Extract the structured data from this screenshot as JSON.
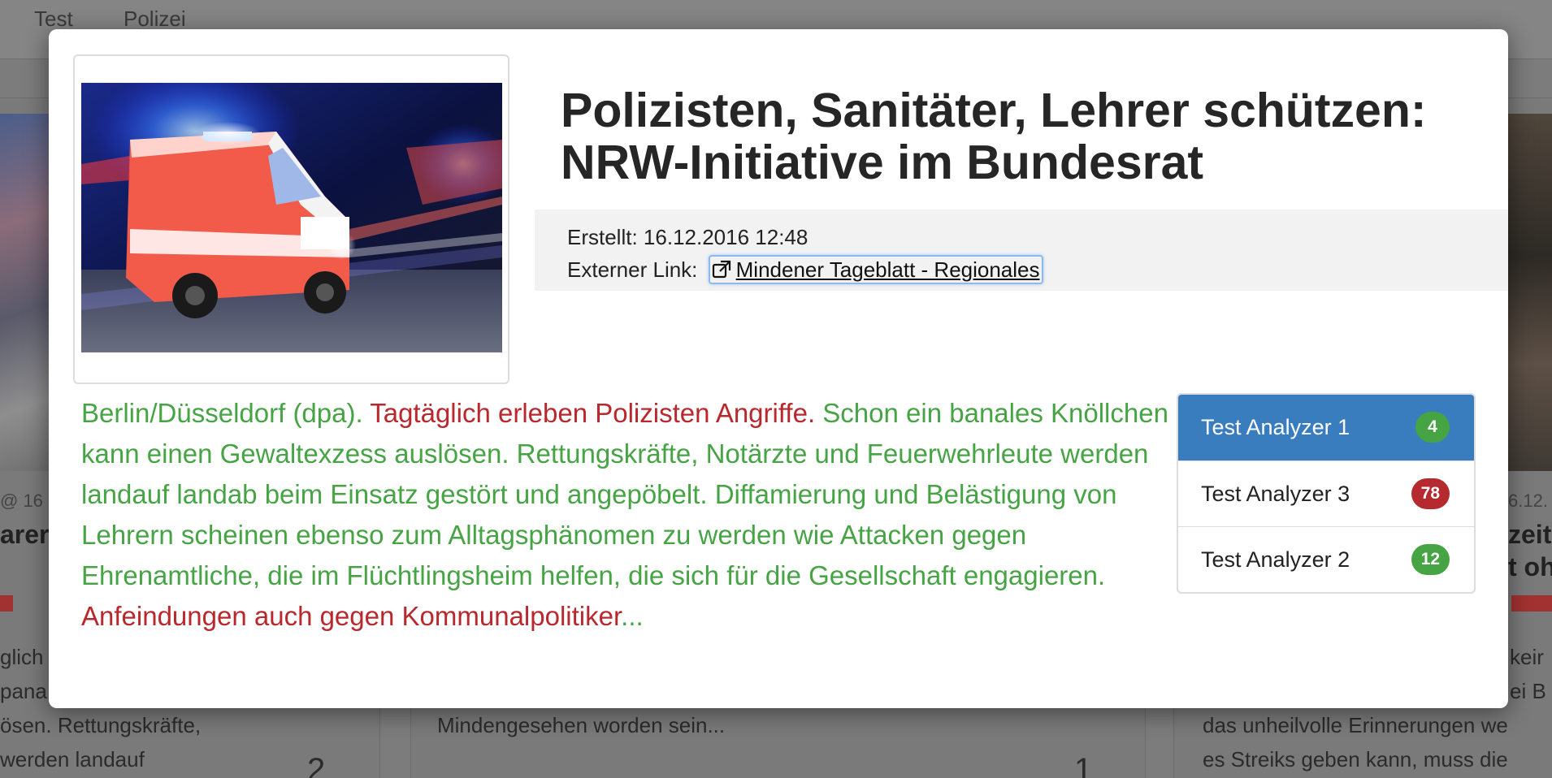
{
  "background": {
    "nav_items": [
      "Test",
      "Polizei"
    ],
    "left_card": {
      "date_fragment": "@ 16",
      "title_fragment": "arer",
      "text_lines": [
        "glich",
        "pana",
        "ösen. Rettungskräfte,",
        "werden landauf"
      ],
      "count": "2"
    },
    "middle_card": {
      "text": "Mindengesehen worden sein...",
      "count": "1"
    },
    "right_card": {
      "date_fragment": "6.12.",
      "title_lines": [
        "zeit",
        "t oh"
      ],
      "text_lines": [
        "keir",
        "ei B",
        "das unheilvolle Erinnerungen we",
        "es Streiks geben kann, muss die"
      ]
    }
  },
  "modal": {
    "title": "Polizisten, Sanitäter, Lehrer schützen: NRW-Initiative im Bundesrat",
    "created_label": "Erstellt:",
    "created_value": "16.12.2016 12:48",
    "link_label": "Externer Link:",
    "link_text": "Mindener Tageblatt - Regionales",
    "link_icon": "external-link-icon",
    "image_alt": "ambulance-at-night-image",
    "body_segments": [
      {
        "text": "Berlin/Düsseldorf (dpa). ",
        "color": "green"
      },
      {
        "text": "Tagtäglich erleben Polizisten Angriffe. ",
        "color": "red"
      },
      {
        "text": "Schon ein banales Knöllchen kann einen Gewaltexzess auslösen. Rettungskräfte, Notärzte und Feuerwehrleute werden landauf landab beim Einsatz gestört und angepöbelt. Diffamierung und Belästigung von Lehrern scheinen ebenso zum Alltagsphänomen zu werden wie Attacken gegen Ehrenamtliche, die im Flüchtlingsheim helfen, die sich für die Gesellschaft engagieren. ",
        "color": "green"
      },
      {
        "text": "Anfeindungen auch gegen Kommunalpolitiker",
        "color": "red"
      },
      {
        "text": "...",
        "color": "green"
      }
    ],
    "analyzers": [
      {
        "label": "Test Analyzer 1",
        "count": "4",
        "badge_color": "#46a445",
        "active": true
      },
      {
        "label": "Test Analyzer 3",
        "count": "78",
        "badge_color": "#b52a2e",
        "active": false
      },
      {
        "label": "Test Analyzer 2",
        "count": "12",
        "badge_color": "#46a445",
        "active": false
      }
    ]
  },
  "colors": {
    "green_text": "#46a445",
    "red_text": "#b8282c",
    "active_item": "#3a7dbf"
  }
}
